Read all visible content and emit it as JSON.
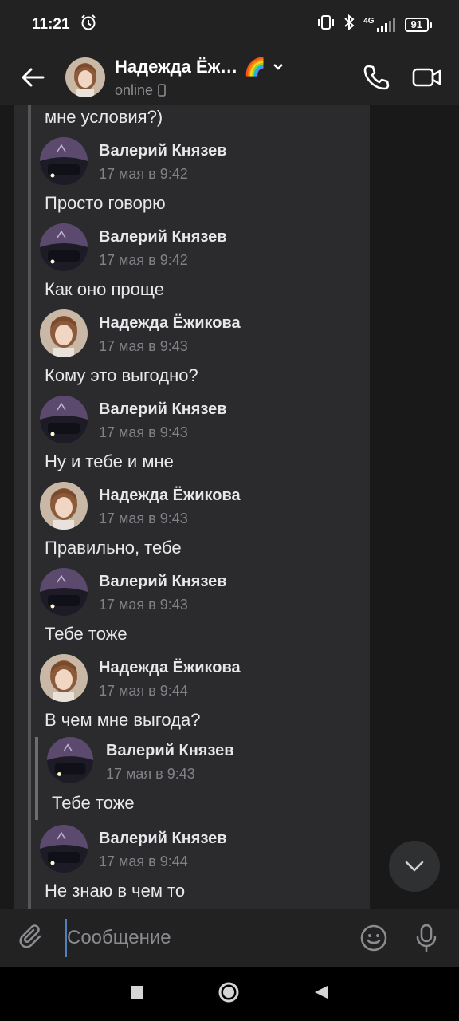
{
  "status_bar": {
    "time": "11:21",
    "network": "4G",
    "battery": "91"
  },
  "header": {
    "title": "Надежда Ёж…",
    "emoji": "🌈",
    "status": "online"
  },
  "chat": {
    "top_text": "мне условия?)",
    "messages": [
      {
        "name": "Валерий Князев",
        "date": "17 мая в 9:42",
        "text": "Просто говорю",
        "avatar": "car"
      },
      {
        "name": "Валерий Князев",
        "date": "17 мая в 9:42",
        "text": "Как оно проще",
        "avatar": "car"
      },
      {
        "name": "Надежда Ёжикова",
        "date": "17 мая в 9:43",
        "text": "Кому это выгодно?",
        "avatar": "girl"
      },
      {
        "name": "Валерий Князев",
        "date": "17 мая в 9:43",
        "text": "Ну и тебе и мне",
        "avatar": "car"
      },
      {
        "name": "Надежда Ёжикова",
        "date": "17 мая в 9:43",
        "text": "Правильно, тебе",
        "avatar": "girl"
      },
      {
        "name": "Валерий Князев",
        "date": "17 мая в 9:43",
        "text": "Тебе тоже",
        "avatar": "car"
      },
      {
        "name": "Надежда Ёжикова",
        "date": "17 мая в 9:44",
        "text": "В чем мне выгода?",
        "avatar": "girl"
      }
    ],
    "nested": {
      "name": "Валерий Князев",
      "date": "17 мая в 9:43",
      "text": "Тебе тоже"
    },
    "last": {
      "name": "Валерий Князев",
      "date": "17 мая в 9:44",
      "text": "Не знаю в чем то"
    }
  },
  "composer": {
    "placeholder": "Сообщение"
  }
}
